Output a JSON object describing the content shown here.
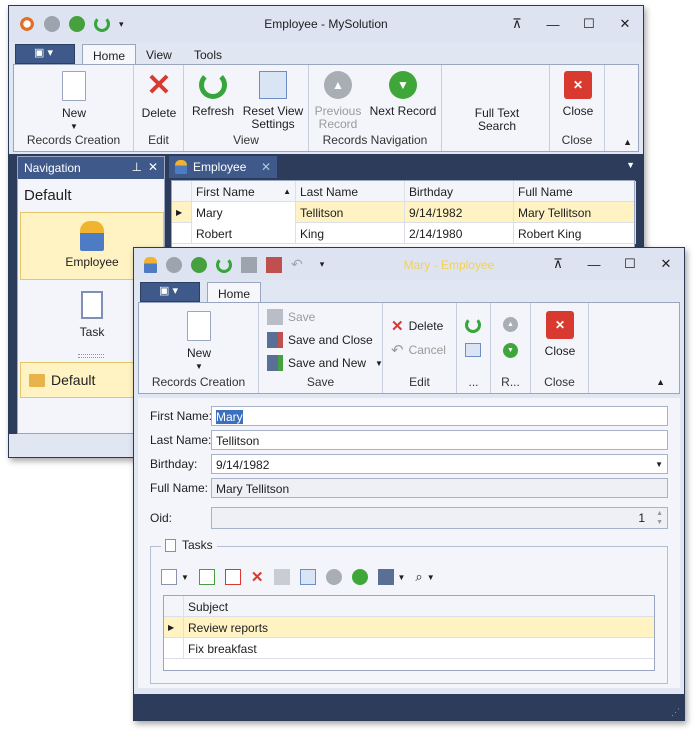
{
  "main": {
    "title": "Employee - MySolution",
    "tabs": [
      "Home",
      "View",
      "Tools"
    ],
    "groups": {
      "records_creation": {
        "label": "Records Creation",
        "new": "New"
      },
      "edit": {
        "label": "Edit",
        "delete": "Delete"
      },
      "view": {
        "label": "View",
        "refresh": "Refresh",
        "reset": "Reset View Settings"
      },
      "nav": {
        "label": "Records Navigation",
        "previous": "Previous Record",
        "next": "Next Record"
      },
      "search": {
        "fulltext": "Full Text Search"
      },
      "close": {
        "label": "Close",
        "close": "Close"
      }
    },
    "navigation": {
      "title": "Navigation",
      "group": "Default",
      "items": [
        "Employee",
        "Task"
      ],
      "footer": "Default"
    },
    "doc_tab": "Employee",
    "grid": {
      "columns": [
        "First Name",
        "Last Name",
        "Birthday",
        "Full Name"
      ],
      "rows": [
        [
          "Mary",
          "Tellitson",
          "9/14/1982",
          "Mary Tellitson"
        ],
        [
          "Robert",
          "King",
          "2/14/1980",
          "Robert King"
        ]
      ]
    }
  },
  "detail": {
    "title": "Mary - Employee",
    "tab": "Home",
    "groups": {
      "records_creation": {
        "label": "Records Creation",
        "new": "New"
      },
      "save": {
        "label": "Save",
        "save": "Save",
        "save_close": "Save and Close",
        "save_new": "Save and New"
      },
      "edit": {
        "label": "Edit",
        "delete": "Delete",
        "cancel": "Cancel"
      },
      "view": {
        "label": "..."
      },
      "nav": {
        "label": "R..."
      },
      "close": {
        "label": "Close",
        "close": "Close"
      }
    },
    "fields": {
      "first_name": {
        "label": "First Name:",
        "value": "Mary"
      },
      "last_name": {
        "label": "Last Name:",
        "value": "Tellitson"
      },
      "birthday": {
        "label": "Birthday:",
        "value": "9/14/1982"
      },
      "full_name": {
        "label": "Full Name:",
        "value": "Mary Tellitson"
      },
      "oid": {
        "label": "Oid:",
        "value": "1"
      }
    },
    "tasks": {
      "title": "Tasks",
      "column": "Subject",
      "rows": [
        "Review reports",
        "Fix breakfast"
      ]
    }
  },
  "colors": {
    "accent": "#3f5a8a",
    "highlight": "#fff3c4",
    "selection": "#fde9a6",
    "delete_red": "#d83a2f",
    "refresh_green": "#36a63a"
  }
}
